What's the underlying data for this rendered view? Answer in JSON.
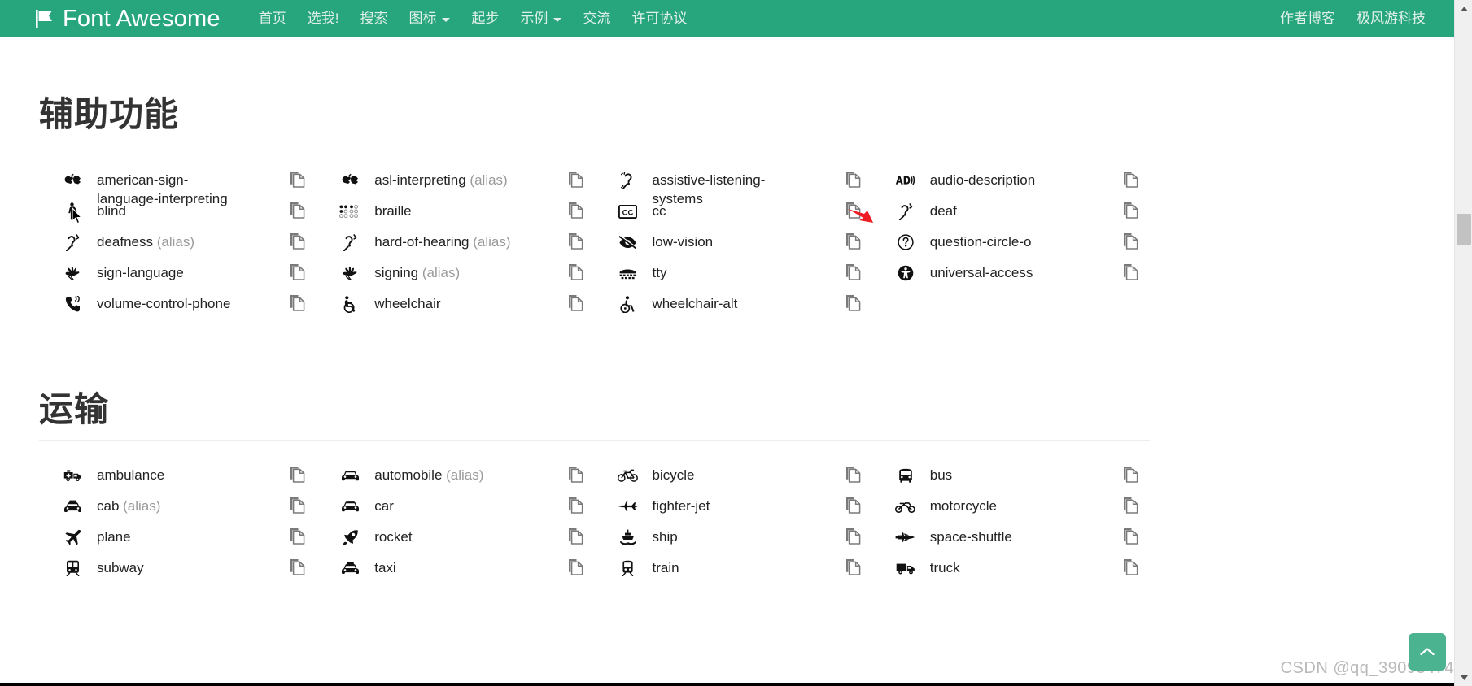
{
  "navbar": {
    "brand": "Font Awesome",
    "brand_icon": "flag-icon",
    "links": [
      {
        "label": "首页",
        "caret": false
      },
      {
        "label": "选我!",
        "caret": false
      },
      {
        "label": "搜索",
        "caret": false
      },
      {
        "label": "图标",
        "caret": true
      },
      {
        "label": "起步",
        "caret": false
      },
      {
        "label": "示例",
        "caret": true
      },
      {
        "label": "交流",
        "caret": false
      },
      {
        "label": "许可协议",
        "caret": false
      }
    ],
    "right_links": [
      {
        "label": "作者博客"
      },
      {
        "label": "极风游科技"
      }
    ],
    "bg_color": "#27a57c",
    "text_color": "#dff0e9"
  },
  "sections": [
    {
      "title": "辅助功能",
      "items": [
        {
          "name": "american-sign-language-interpreting",
          "alias": false,
          "icon": "asl-interpreting-icon"
        },
        {
          "name": "asl-interpreting",
          "alias": true,
          "icon": "asl-interpreting-icon"
        },
        {
          "name": "assistive-listening-systems",
          "alias": false,
          "icon": "assistive-listening-icon"
        },
        {
          "name": "audio-description",
          "alias": false,
          "icon": "audio-description-icon"
        },
        {
          "name": "blind",
          "alias": false,
          "icon": "blind-icon"
        },
        {
          "name": "braille",
          "alias": false,
          "icon": "braille-icon"
        },
        {
          "name": "cc",
          "alias": false,
          "icon": "closed-captioning-icon"
        },
        {
          "name": "deaf",
          "alias": false,
          "icon": "deaf-icon"
        },
        {
          "name": "deafness",
          "alias": true,
          "icon": "deaf-icon"
        },
        {
          "name": "hard-of-hearing",
          "alias": true,
          "icon": "deaf-icon"
        },
        {
          "name": "low-vision",
          "alias": false,
          "icon": "low-vision-icon"
        },
        {
          "name": "question-circle-o",
          "alias": false,
          "icon": "question-circle-o-icon"
        },
        {
          "name": "sign-language",
          "alias": false,
          "icon": "sign-language-icon"
        },
        {
          "name": "signing",
          "alias": true,
          "icon": "sign-language-icon"
        },
        {
          "name": "tty",
          "alias": false,
          "icon": "tty-icon"
        },
        {
          "name": "universal-access",
          "alias": false,
          "icon": "universal-access-icon"
        },
        {
          "name": "volume-control-phone",
          "alias": false,
          "icon": "volume-control-phone-icon"
        },
        {
          "name": "wheelchair",
          "alias": false,
          "icon": "wheelchair-icon"
        },
        {
          "name": "wheelchair-alt",
          "alias": false,
          "icon": "wheelchair-alt-icon"
        }
      ]
    },
    {
      "title": "运输",
      "items": [
        {
          "name": "ambulance",
          "alias": false,
          "icon": "ambulance-icon"
        },
        {
          "name": "automobile",
          "alias": true,
          "icon": "car-icon"
        },
        {
          "name": "bicycle",
          "alias": false,
          "icon": "bicycle-icon"
        },
        {
          "name": "bus",
          "alias": false,
          "icon": "bus-icon"
        },
        {
          "name": "cab",
          "alias": true,
          "icon": "taxi-icon"
        },
        {
          "name": "car",
          "alias": false,
          "icon": "car-icon"
        },
        {
          "name": "fighter-jet",
          "alias": false,
          "icon": "fighter-jet-icon"
        },
        {
          "name": "motorcycle",
          "alias": false,
          "icon": "motorcycle-icon"
        },
        {
          "name": "plane",
          "alias": false,
          "icon": "plane-icon"
        },
        {
          "name": "rocket",
          "alias": false,
          "icon": "rocket-icon"
        },
        {
          "name": "ship",
          "alias": false,
          "icon": "ship-icon"
        },
        {
          "name": "space-shuttle",
          "alias": false,
          "icon": "space-shuttle-icon"
        },
        {
          "name": "subway",
          "alias": false,
          "icon": "subway-icon"
        },
        {
          "name": "taxi",
          "alias": false,
          "icon": "taxi-icon"
        },
        {
          "name": "train",
          "alias": false,
          "icon": "train-icon"
        },
        {
          "name": "truck",
          "alias": false,
          "icon": "truck-icon"
        }
      ]
    }
  ],
  "alias_suffix": "(alias)",
  "copy_icon": "copy-icon",
  "annotation": {
    "arrow_color": "#ee1d23",
    "points_at": "copy-icon-for-cc"
  },
  "back_to_top": {
    "icon": "chevron-up-icon",
    "color": "#4cb391"
  },
  "watermark": "CSDN @qq_39093474",
  "scrollbar": {
    "up_icon": "scroll-up-arrow-icon",
    "down_icon": "scroll-down-arrow-icon"
  }
}
